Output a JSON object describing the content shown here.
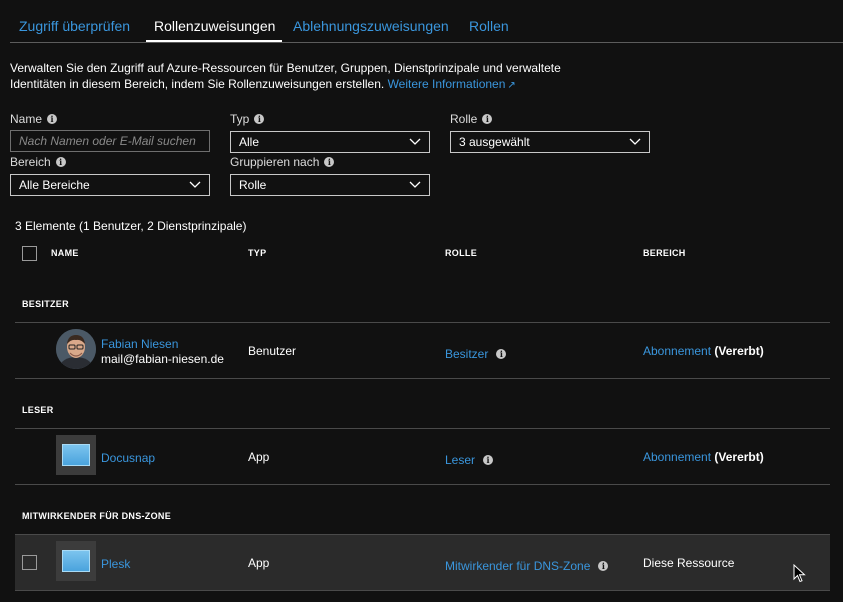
{
  "tabs": [
    {
      "label": "Zugriff überprüfen",
      "active": false
    },
    {
      "label": "Rollenzuweisungen",
      "active": true
    },
    {
      "label": "Ablehnungszuweisungen",
      "active": false
    },
    {
      "label": "Rollen",
      "active": false
    }
  ],
  "description": {
    "text": "Verwalten Sie den Zugriff auf Azure-Ressourcen für Benutzer, Gruppen, Dienstprinzipale und verwaltete Identitäten in diesem Bereich, indem Sie Rollenzuweisungen erstellen.",
    "link": "Weitere Informationen"
  },
  "filters": {
    "name": {
      "label": "Name",
      "placeholder": "Nach Namen oder E-Mail suchen",
      "value": ""
    },
    "typ": {
      "label": "Typ",
      "value": "Alle"
    },
    "rolle": {
      "label": "Rolle",
      "value": "3 ausgewählt"
    },
    "bereich": {
      "label": "Bereich",
      "value": "Alle Bereiche"
    },
    "gruppieren": {
      "label": "Gruppieren nach",
      "value": "Rolle"
    }
  },
  "summary": "3 Elemente (1 Benutzer, 2 Dienstprinzipale)",
  "table": {
    "columns": {
      "name": "NAME",
      "typ": "TYP",
      "rolle": "ROLLE",
      "bereich": "BEREICH"
    },
    "groups": [
      {
        "title": "BESITZER",
        "rows": [
          {
            "name": "Fabian Niesen",
            "email": "mail@fabian-niesen.de",
            "typ": "Benutzer",
            "rolle": "Besitzer",
            "bereich_link": "Abonnement",
            "bereich_suffix": "(Vererbt)",
            "icon": "user-avatar"
          }
        ]
      },
      {
        "title": "LESER",
        "rows": [
          {
            "name": "Docusnap",
            "email": "",
            "typ": "App",
            "rolle": "Leser",
            "bereich_link": "Abonnement",
            "bereich_suffix": "(Vererbt)",
            "icon": "app-icon"
          }
        ]
      },
      {
        "title": "MITWIRKENDER FÜR DNS-ZONE",
        "rows": [
          {
            "name": "Plesk",
            "email": "",
            "typ": "App",
            "rolle": "Mitwirkender für DNS-Zone",
            "bereich_text": "Diese Ressource",
            "icon": "app-icon"
          }
        ]
      }
    ]
  },
  "colors": {
    "background": "#111111",
    "link": "#3a96dd",
    "separator": "#4a4a4a",
    "row_highlight": "#2b2b2b"
  }
}
